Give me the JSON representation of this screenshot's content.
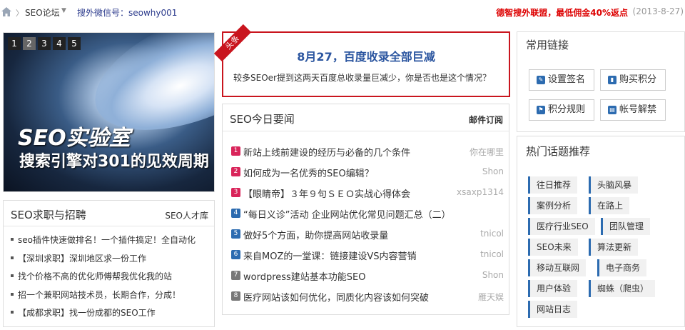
{
  "header": {
    "crumb_forum": "SEO论坛",
    "wechat": "搜外微信号：seowhy001",
    "promo": "德智搜外联盟，最低佣金40%返点",
    "date": "(2013-8-27)"
  },
  "slider": {
    "numbers": [
      "1",
      "2",
      "3",
      "4",
      "5"
    ],
    "active": "2",
    "title1": "SEO实验室",
    "title2": "搜索引擎对301的见效周期"
  },
  "jobs": {
    "title": "SEO求职与招聘",
    "more": "SEO人才库",
    "items": [
      "seo插件快速做排名！一个插件搞定！全自动化",
      "【深圳求职】深圳地区求一份工作",
      "找个价格不高的优化师傅帮我优化我的站",
      "招一个兼职网站技术员，长期合作，分成！",
      "【成都求职】找一份成都的SEO工作"
    ]
  },
  "headline": {
    "ribbon": "头条",
    "title": "8月27，百度收录全部巨减",
    "desc": "较多SEOer提到这两天百度总收录量巨减少，你是否也是这个情况？"
  },
  "news": {
    "title": "SEO今日要闻",
    "subscribe": "邮件订阅",
    "items": [
      {
        "rank": "1",
        "color": "#d9245a",
        "title": "新站上线前建设的经历与必备的几个条件",
        "author": "你在哪里"
      },
      {
        "rank": "2",
        "color": "#d9245a",
        "title": "如何成为一名优秀的SEO编辑？",
        "author": "Shon"
      },
      {
        "rank": "3",
        "color": "#d9245a",
        "title": "【眼睛帝】３年９句ＳＥＯ实战心得体会",
        "author": "xsaxp1314"
      },
      {
        "rank": "4",
        "color": "#2c6bb0",
        "title": "“每日义诊”活动 企业网站优化常见问题汇总（二）",
        "author": ""
      },
      {
        "rank": "5",
        "color": "#2c6bb0",
        "title": "做好5个方面，助你提高网站收录量",
        "author": "tnicol"
      },
      {
        "rank": "6",
        "color": "#2c6bb0",
        "title": "来自MOZ的一堂课：链接建设VS内容营销",
        "author": "tnicol"
      },
      {
        "rank": "7",
        "color": "#777777",
        "title": "wordpress建站基本功能SEO",
        "author": "Shon"
      },
      {
        "rank": "8",
        "color": "#777777",
        "title": "医疗网站该如何优化，同质化内容该如何突破",
        "author": "雁天娱"
      }
    ]
  },
  "links": {
    "title": "常用链接",
    "buttons": [
      {
        "label": "设置签名",
        "icon": "edit-icon"
      },
      {
        "label": "购买积分",
        "icon": "bar-chart-icon"
      },
      {
        "label": "积分规则",
        "icon": "flag-icon"
      },
      {
        "label": "帐号解禁",
        "icon": "book-icon"
      }
    ]
  },
  "topics": {
    "title": "热门话题推荐",
    "tags": [
      "往日推荐",
      "头脑风暴",
      "案例分析",
      "在路上",
      "医疗行业SEO",
      "团队管理",
      "SEO未来",
      "算法更新",
      "移动互联网",
      "电子商务",
      "用户体验",
      "蜘蛛（爬虫）",
      "网站日志"
    ]
  }
}
